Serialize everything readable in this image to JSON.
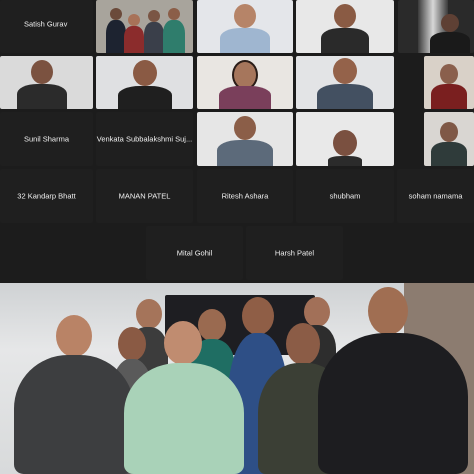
{
  "participants": {
    "satish": "Satish Gurav",
    "sunil": "Sunil Sharma",
    "venkata": "Venkata Subbalakshmi Suj...",
    "kandarp": "32 Kandarp Bhatt",
    "manan": "MANAN PATEL",
    "ritesh": "Ritesh Ashara",
    "shubham": "shubham",
    "soham": "soham namama",
    "mital": "Mital Gohil",
    "harsh": "Harsh Patel"
  },
  "colors": {
    "tile_bg": "#1f1f1f",
    "grid_bg": "#1c1c1c",
    "name_text": "#f1f1f1"
  },
  "icons": {
    "video_feed": "webcam-video",
    "group_photo": "group-photo"
  }
}
